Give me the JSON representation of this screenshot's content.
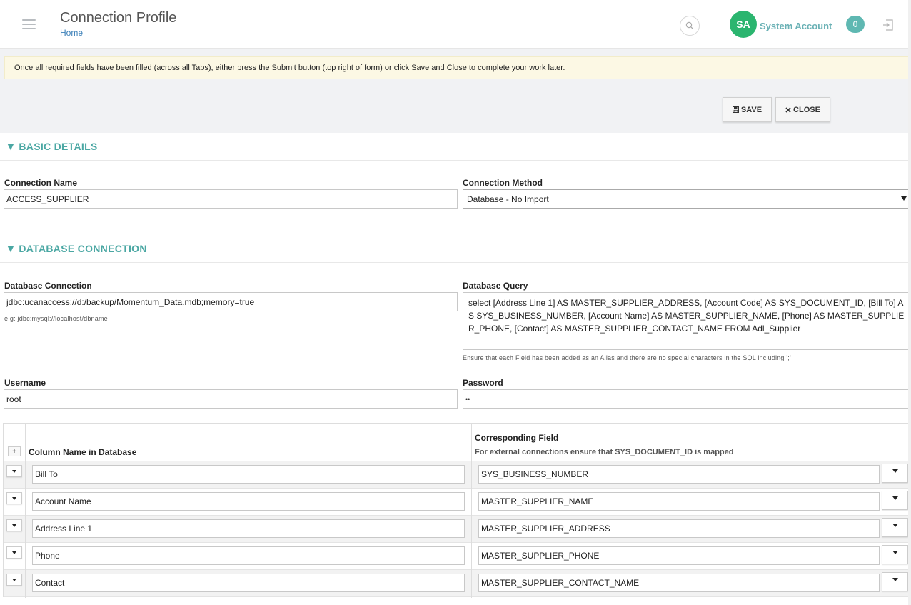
{
  "header": {
    "title": "Connection Profile",
    "breadcrumb": "Home",
    "user_initials": "SA",
    "user_name": "System Account",
    "notification_count": "0"
  },
  "notice": "Once all required fields have been filled (across all Tabs), either press the Submit button (top right of form) or click Save and Close to complete your work later.",
  "toolbar": {
    "save_label": "SAVE",
    "close_label": "CLOSE"
  },
  "basic_details": {
    "section_title": "BASIC DETAILS",
    "connection_name_label": "Connection Name",
    "connection_name_value": "ACCESS_SUPPLIER",
    "connection_method_label": "Connection Method",
    "connection_method_value": "Database - No Import"
  },
  "database_connection": {
    "section_title": "DATABASE CONNECTION",
    "db_connection_label": "Database Connection",
    "db_connection_value": "jdbc:ucanaccess://d:/backup/Momentum_Data.mdb;memory=true",
    "db_connection_help": "e,g: jdbc:mysql://localhost/dbname",
    "db_query_label": "Database Query",
    "db_query_value": "select [Address Line 1]  AS MASTER_SUPPLIER_ADDRESS, [Account Code] AS SYS_DOCUMENT_ID, [Bill To] AS SYS_BUSINESS_NUMBER, [Account Name] AS MASTER_SUPPLIER_NAME, [Phone] AS MASTER_SUPPLIER_PHONE, [Contact] AS MASTER_SUPPLIER_CONTACT_NAME FROM Adl_Supplier",
    "db_query_help": "Ensure that each Field has been added as an Alias and there are no special characters in the SQL including ';'",
    "username_label": "Username",
    "username_value": "root",
    "password_label": "Password",
    "password_value": "••"
  },
  "mapping": {
    "add_label": "+",
    "column_header": "Column Name in Database",
    "field_header": "Corresponding Field",
    "field_subheader": "For external connections ensure that SYS_DOCUMENT_ID is mapped",
    "rows": [
      {
        "column": "Bill To",
        "field": "SYS_BUSINESS_NUMBER"
      },
      {
        "column": "Account Name",
        "field": "MASTER_SUPPLIER_NAME"
      },
      {
        "column": "Address Line 1",
        "field": "MASTER_SUPPLIER_ADDRESS"
      },
      {
        "column": "Phone",
        "field": "MASTER_SUPPLIER_PHONE"
      },
      {
        "column": "Contact",
        "field": "MASTER_SUPPLIER_CONTACT_NAME"
      }
    ]
  },
  "colors": {
    "accent": "#4aa7a3",
    "avatar": "#2bb56f",
    "badge": "#5fb8b2",
    "notice_bg": "#fcf8e4"
  },
  "icons": {
    "menu": "hamburger-icon",
    "search": "search-icon",
    "logout": "logout-icon",
    "save": "floppy-disk-icon",
    "close": "close-icon",
    "section_toggle": "triangle-down-icon"
  }
}
